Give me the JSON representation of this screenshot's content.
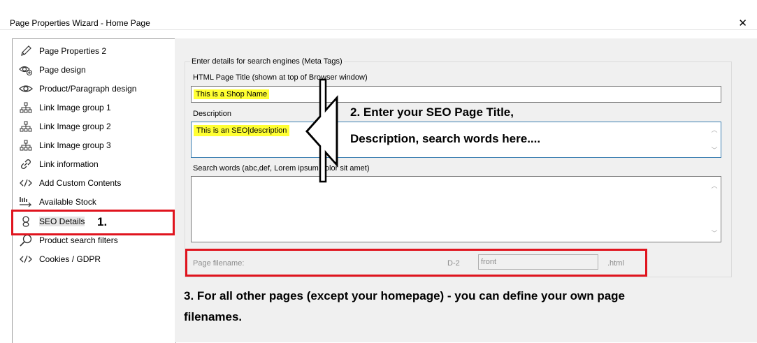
{
  "window": {
    "title": "Page Properties Wizard - Home Page",
    "close_glyph": "✕"
  },
  "sidebar": {
    "items": [
      {
        "label": "Page Properties 2",
        "icon": "pencil-icon"
      },
      {
        "label": "Page design",
        "icon": "eye-settings-icon"
      },
      {
        "label": "Product/Paragraph design",
        "icon": "eye-icon"
      },
      {
        "label": "Link Image group 1",
        "icon": "sitemap-icon"
      },
      {
        "label": "Link Image group 2",
        "icon": "sitemap-icon"
      },
      {
        "label": "Link Image group 3",
        "icon": "sitemap-icon"
      },
      {
        "label": "Link information",
        "icon": "link-icon"
      },
      {
        "label": "Add Custom Contents",
        "icon": "code-icon"
      },
      {
        "label": "Available Stock",
        "icon": "stock-icon"
      },
      {
        "label": "SEO Details",
        "icon": "seo-icon",
        "selected": true
      },
      {
        "label": "Product search filters",
        "icon": "search-icon"
      },
      {
        "label": "Cookies / GDPR",
        "icon": "code-icon"
      }
    ]
  },
  "seo": {
    "group_title": "Enter details for search engines (Meta Tags)",
    "html_title_label": "HTML Page Title (shown at top of Browser window)",
    "html_title_value": "This is a Shop Name",
    "description_label": "Description",
    "description_value": "This is an SEO|description",
    "search_words_label": "Search words (abc,def, Lorem ipsum dolor sit amet)",
    "search_words_value": "",
    "filename_label": "Page filename:",
    "filename_code": "D-2",
    "filename_value": "front",
    "filename_ext": ".html"
  },
  "annotations": {
    "step1": "1.",
    "step2_line1": "2. Enter your SEO Page Title,",
    "step2_line2": "Description, search words here....",
    "step3_line1": "3. For all other pages (except your homepage) - you can define your own page",
    "step3_line2": "filenames."
  },
  "colors": {
    "highlight": "#ffff33",
    "annotation_red": "#e0141e",
    "field_focus_blue": "#3c7fb1"
  }
}
